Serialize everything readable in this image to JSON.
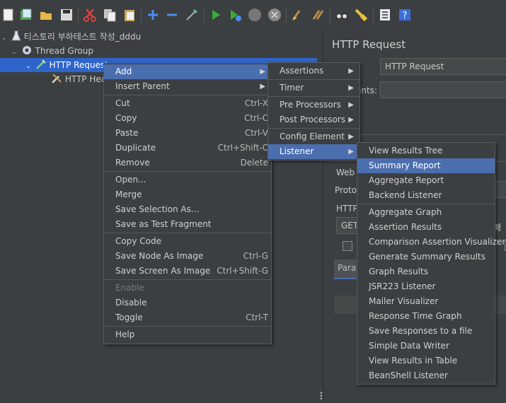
{
  "toolbar": {
    "icons": [
      "new-icon",
      "templates-icon",
      "open-icon",
      "save-icon",
      "cut-icon",
      "copy-icon",
      "paste-icon",
      "expand-icon",
      "collapse-icon",
      "toggle-icon",
      "start-icon",
      "start-no-pause-icon",
      "stop-icon",
      "shutdown-icon",
      "clear-icon",
      "clear-all-icon",
      "search-icon",
      "reset-search-icon",
      "function-helper-icon",
      "help-icon"
    ]
  },
  "tree": {
    "items": [
      {
        "label": "티스토리 부하테스트 작성_dddu"
      },
      {
        "label": "Thread Group"
      },
      {
        "label": "HTTP Request"
      },
      {
        "label": "HTTP Hea"
      }
    ]
  },
  "right": {
    "title": "HTTP Request",
    "name_value": "HTTP Request",
    "comments_label": "ents:",
    "web_label": "Web",
    "protocol_label": "Proto",
    "http_label": "HTTP",
    "method_value": "GET",
    "tab_label": "Para",
    "suffix_text": "패"
  },
  "context_menu": {
    "groups": [
      [
        {
          "label": "Add",
          "submenu": true
        },
        {
          "label": "Insert Parent",
          "submenu": true
        }
      ],
      [
        {
          "label": "Cut",
          "shortcut": "Ctrl-X"
        },
        {
          "label": "Copy",
          "shortcut": "Ctrl-C"
        },
        {
          "label": "Paste",
          "shortcut": "Ctrl-V"
        },
        {
          "label": "Duplicate",
          "shortcut": "Ctrl+Shift-C"
        },
        {
          "label": "Remove",
          "shortcut": "Delete"
        }
      ],
      [
        {
          "label": "Open..."
        },
        {
          "label": "Merge"
        },
        {
          "label": "Save Selection As..."
        },
        {
          "label": "Save as Test Fragment"
        }
      ],
      [
        {
          "label": "Copy Code"
        },
        {
          "label": "Save Node As Image",
          "shortcut": "Ctrl-G"
        },
        {
          "label": "Save Screen As Image",
          "shortcut": "Ctrl+Shift-G"
        }
      ],
      [
        {
          "label": "Enable",
          "disabled": true
        },
        {
          "label": "Disable"
        },
        {
          "label": "Toggle",
          "shortcut": "Ctrl-T"
        }
      ],
      [
        {
          "label": "Help"
        }
      ]
    ]
  },
  "add_menu": {
    "groups": [
      [
        {
          "label": "Assertions"
        }
      ],
      [
        {
          "label": "Timer"
        }
      ],
      [
        {
          "label": "Pre Processors"
        },
        {
          "label": "Post Processors"
        }
      ],
      [
        {
          "label": "Config Element"
        },
        {
          "label": "Listener"
        }
      ]
    ]
  },
  "listener_menu": {
    "groups": [
      [
        {
          "label": "View Results Tree"
        },
        {
          "label": "Summary Report"
        },
        {
          "label": "Aggregate Report"
        },
        {
          "label": "Backend Listener"
        }
      ],
      [
        {
          "label": "Aggregate Graph"
        },
        {
          "label": "Assertion Results"
        },
        {
          "label": "Comparison Assertion Visualizer"
        },
        {
          "label": "Generate Summary Results"
        },
        {
          "label": "Graph Results"
        },
        {
          "label": "JSR223 Listener"
        },
        {
          "label": "Mailer Visualizer"
        },
        {
          "label": "Response Time Graph"
        },
        {
          "label": "Save Responses to a file"
        },
        {
          "label": "Simple Data Writer"
        },
        {
          "label": "View Results in Table"
        },
        {
          "label": "BeanShell Listener"
        }
      ]
    ]
  }
}
